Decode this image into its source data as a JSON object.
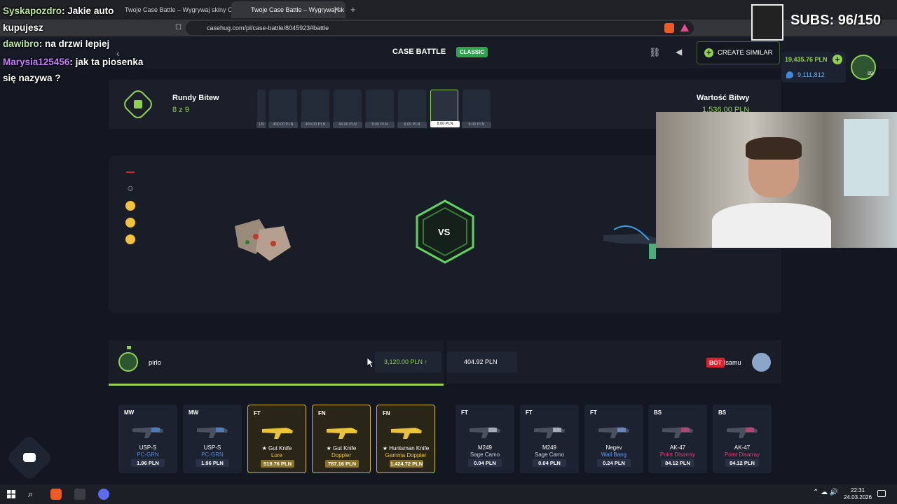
{
  "browser": {
    "tabs": [
      {
        "label": "Twoje Case Battle – Wygrywaj skiny C",
        "active": false
      },
      {
        "label": "Twoje Case Battle – Wygrywaj sk",
        "active": true
      }
    ],
    "new_tab_label": "+",
    "url": "casehug.com/pl/case-battle/8045923#battle"
  },
  "header": {
    "title": "CASE BATTLE",
    "badge": "CLASSIC",
    "create_similar_label": "CREATE SIMILAR",
    "balance_main": "19,435.76 PLN",
    "balance_sub": "9,111,812",
    "level": "89"
  },
  "rounds": {
    "label": "Rundy Bitew",
    "value": "8 z 9",
    "battle_value_label": "Wartość Bitwy",
    "battle_value": "1,536.00 PLN",
    "cases": [
      {
        "price": "LN",
        "active": false
      },
      {
        "price": "400.00 PLN",
        "active": false
      },
      {
        "price": "400.00 PLN",
        "active": false
      },
      {
        "price": "44.00 PLN",
        "active": false
      },
      {
        "price": "8.00 PLN",
        "active": false
      },
      {
        "price": "8.00 PLN",
        "active": false
      },
      {
        "price": "8.00 PLN",
        "active": true
      },
      {
        "price": "8.00 PLN",
        "active": false
      }
    ]
  },
  "arena": {
    "vs_label": "VS"
  },
  "players": {
    "p1_name": "pirlo",
    "p1_total": "3,120.00 PLN ↑",
    "p2_total": "404.92 PLN",
    "bot_badge": "BOT",
    "p2_name": "Isamu"
  },
  "items": [
    {
      "wear": "MW",
      "name": "USP-S",
      "skin": "PC-GRN",
      "price": "1.96 PLN",
      "gold": false,
      "color": "#4b8bdf"
    },
    {
      "wear": "MW",
      "name": "USP-S",
      "skin": "PC-GRN",
      "price": "1.96 PLN",
      "gold": false,
      "color": "#4b8bdf"
    },
    {
      "wear": "FT",
      "name": "★ Gut Knife",
      "skin": "Lore",
      "price": "519.76 PLN",
      "gold": true,
      "color": "#f0c93a"
    },
    {
      "wear": "FN",
      "name": "★ Gut Knife",
      "skin": "Doppler",
      "price": "787.16 PLN",
      "gold": true,
      "color": "#f0c93a"
    },
    {
      "wear": "FN",
      "name": "★ Huntsman Knife",
      "skin": "Gamma Doppler",
      "price": "1,424.72 PLN",
      "gold": true,
      "color": "#f0c93a"
    },
    {
      "wear": "FT",
      "name": "M249",
      "skin": "Sage Camo",
      "price": "0.04 PLN",
      "gold": false,
      "color": "#c9d2de"
    },
    {
      "wear": "FT",
      "name": "M249",
      "skin": "Sage Camo",
      "price": "0.04 PLN",
      "gold": false,
      "color": "#c9d2de"
    },
    {
      "wear": "FT",
      "name": "Negev",
      "skin": "Wall Bang",
      "price": "0.24 PLN",
      "gold": false,
      "color": "#6f9ee8"
    },
    {
      "wear": "BS",
      "name": "AK-47",
      "skin": "Point Disarray",
      "price": "84.12 PLN",
      "gold": false,
      "color": "#e0407a"
    },
    {
      "wear": "BS",
      "name": "AK-47",
      "skin": "Point Disarray",
      "price": "84.12 PLN",
      "gold": false,
      "color": "#e0407a"
    }
  ],
  "overlay": {
    "subs": "SUBS: 96/150",
    "chat": [
      {
        "user": "Syskapozdro",
        "msg": "Jakie auto"
      },
      {
        "user": "",
        "msg": "kupujesz"
      },
      {
        "user": "dawibro",
        "msg": "na drzwi lepiej"
      },
      {
        "user": "Marysia125456",
        "msg": "jak ta piosenka"
      },
      {
        "user": "",
        "msg": "się nazywa ?"
      }
    ]
  },
  "taskbar": {
    "time": "22:31",
    "date": "24.03.2026"
  }
}
